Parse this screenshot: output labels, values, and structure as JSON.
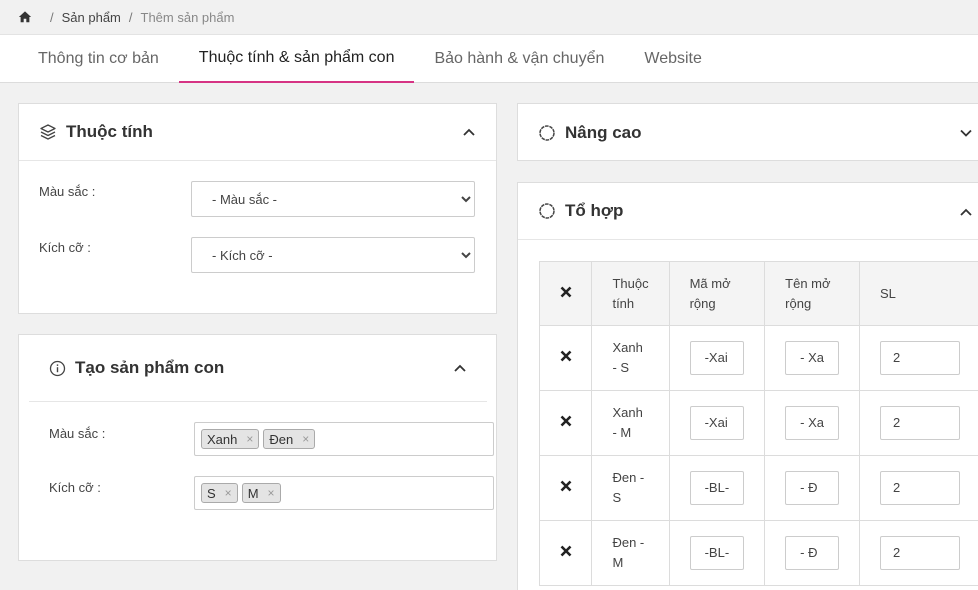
{
  "breadcrumb": {
    "items": [
      "Sản phẩm",
      "Thêm sản phẩm"
    ],
    "separator": "/"
  },
  "tabs": [
    {
      "label": "Thông tin cơ bản",
      "active": false
    },
    {
      "label": "Thuộc tính & sản phẩm con",
      "active": true
    },
    {
      "label": "Bảo hành & vận chuyển",
      "active": false
    },
    {
      "label": "Website",
      "active": false
    }
  ],
  "accent_color": "#d63384",
  "attributes_card": {
    "title": "Thuộc tính",
    "color_label": "Màu sắc :",
    "color_select": "- Màu sắc -",
    "size_label": "Kích cỡ :",
    "size_select": "- Kích cỡ -"
  },
  "variants_card": {
    "title": "Tạo sản phẩm con",
    "color_label": "Màu sắc :",
    "color_tags": [
      "Xanh",
      "Đen"
    ],
    "size_label": "Kích cỡ :",
    "size_tags": [
      "S",
      "M"
    ]
  },
  "advanced_card": {
    "title": "Nâng cao"
  },
  "combo_card": {
    "title": "Tổ hợp",
    "headers": {
      "attribute": [
        "Thuộc",
        "tính"
      ],
      "sku_ext": [
        "Mã mở",
        "rộng"
      ],
      "name_ext": [
        "Tên mở",
        "rộng"
      ],
      "qty": "SL"
    },
    "rows": [
      {
        "attr1": "Xanh",
        "attr2": "- S",
        "sku": "-Xai",
        "name": "- Xa",
        "qty": "2"
      },
      {
        "attr1": "Xanh",
        "attr2": "- M",
        "sku": "-Xai",
        "name": "- Xa",
        "qty": "2"
      },
      {
        "attr1": "Đen -",
        "attr2": "S",
        "sku": "-BL-",
        "name": "- Đ",
        "qty": "2"
      },
      {
        "attr1": "Đen -",
        "attr2": "M",
        "sku": "-BL-",
        "name": "- Đ",
        "qty": "2"
      }
    ]
  }
}
